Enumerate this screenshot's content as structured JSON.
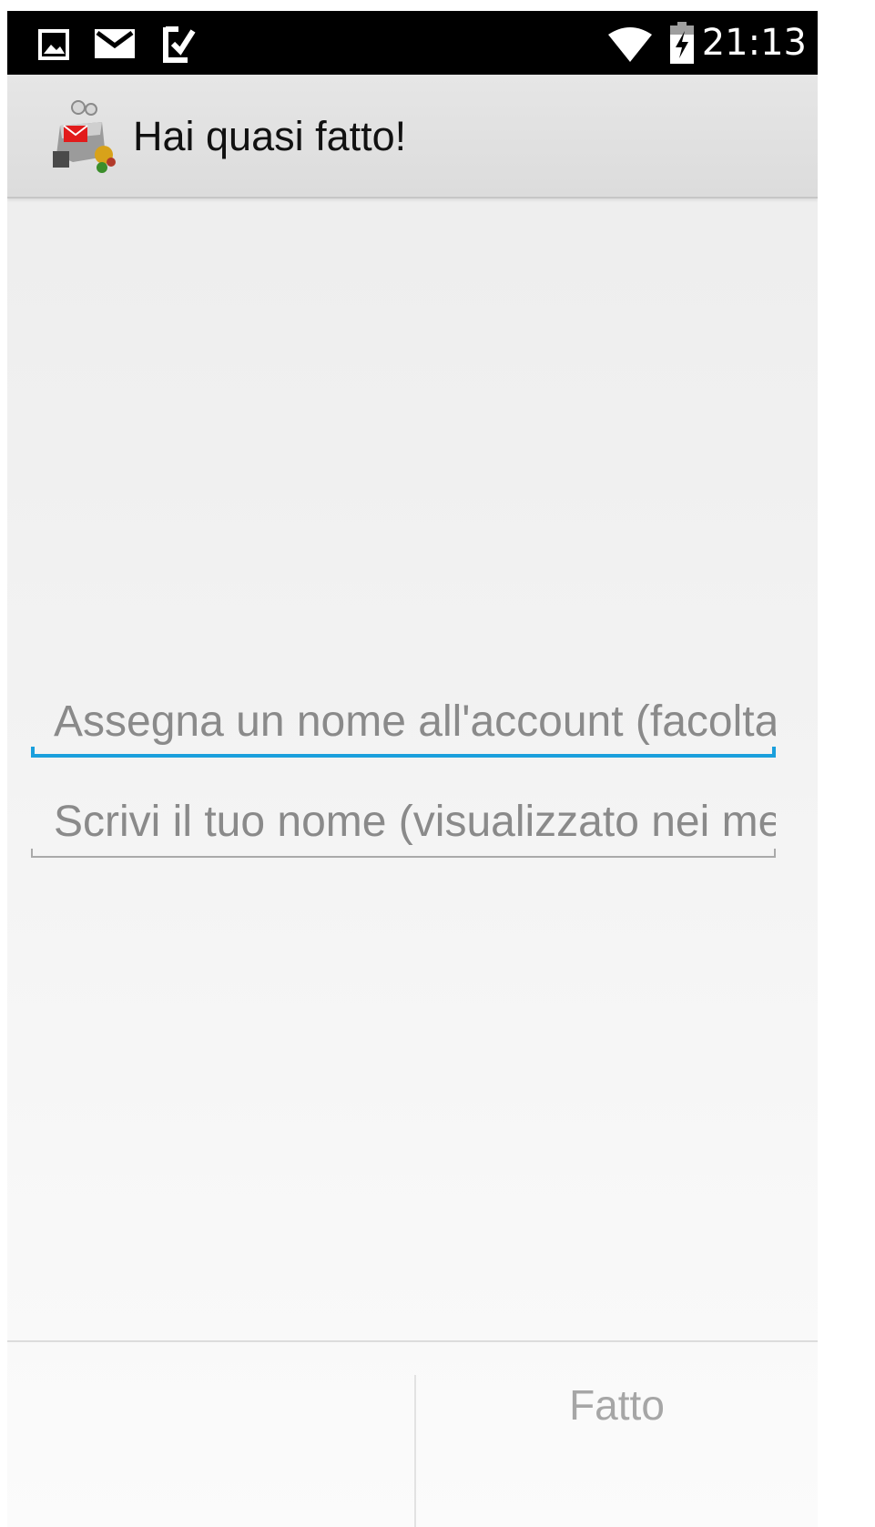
{
  "status_bar": {
    "time": "21:13",
    "left_icons": [
      "gallery-icon",
      "mail-icon",
      "checkmark-clipboard-icon"
    ],
    "right_icons": [
      "wifi-icon",
      "battery-charging-icon"
    ]
  },
  "action_bar": {
    "title": "Hai quasi fatto!",
    "app_icon": "app-logo-icon"
  },
  "form": {
    "account_name_placeholder": "Assegna un nome all'account (facoltativo)",
    "account_name_value": "",
    "your_name_placeholder": "Scrivi il tuo nome (visualizzato nei messaggi in uscita)",
    "your_name_value": ""
  },
  "bottom_bar": {
    "done_label": "Fatto"
  },
  "colors": {
    "accent": "#1a9fdc",
    "status_bar": "#000000",
    "action_bar": "#dcdcdc",
    "disabled_text": "#a6a6a6"
  }
}
